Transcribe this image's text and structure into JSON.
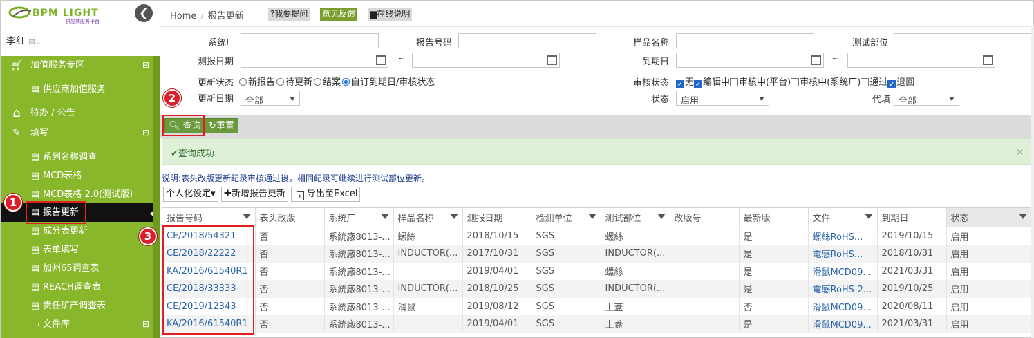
{
  "brand": {
    "logo_text": "BPM LIGHT",
    "logo_sub": "供应商服务平台"
  },
  "user": {
    "name": "李红"
  },
  "sidebar": {
    "items": [
      {
        "label": "加值服务专区",
        "icon": "cart-icon",
        "level": 1,
        "toggle": "⊟"
      },
      {
        "label": "供应商加值服务",
        "icon": "file-icon",
        "level": 2
      },
      {
        "label": "待办 / 公告",
        "icon": "home-icon",
        "level": 1
      },
      {
        "label": "填写",
        "icon": "edit-icon",
        "level": 1,
        "toggle": "⊟"
      },
      {
        "label": "系列名称调查",
        "icon": "file-icon",
        "level": 2
      },
      {
        "label": "MCD表格",
        "icon": "file-icon",
        "level": 2
      },
      {
        "label": "MCD表格 2.0(测试版)",
        "icon": "file-icon",
        "level": 2
      },
      {
        "label": "报告更新",
        "icon": "file-icon",
        "level": 2,
        "active": true
      },
      {
        "label": "成分表更新",
        "icon": "file-icon",
        "level": 2
      },
      {
        "label": "表单填写",
        "icon": "file-icon",
        "level": 2
      },
      {
        "label": "加州65调查表",
        "icon": "file-icon",
        "level": 2
      },
      {
        "label": "REACH调查表",
        "icon": "file-icon",
        "level": 2
      },
      {
        "label": "责任矿产调查表",
        "icon": "file-icon",
        "level": 2
      },
      {
        "label": "文件库",
        "icon": "folder-icon",
        "level": 2,
        "toggle": "⊟"
      }
    ]
  },
  "badges": [
    "1",
    "2",
    "3"
  ],
  "breadcrumb": {
    "home": "Home",
    "sep": "/",
    "current": "报告更新"
  },
  "toolbar": {
    "ask": "?我要提问",
    "feedback": "意见反馈",
    "help": "在线说明"
  },
  "filters": {
    "factory_label": "系统厂",
    "report_no_label": "报告号码",
    "sample_label": "样品名称",
    "part_label": "测试部位",
    "test_date_label": "测报日期",
    "tilde": "~",
    "due_label": "到期日",
    "update_status_label": "更新状态",
    "update_status_options": [
      {
        "label": "新报告",
        "checked": false
      },
      {
        "label": "待更新",
        "checked": false
      },
      {
        "label": "结案",
        "checked": false
      },
      {
        "label": "自订到期日/审核状态",
        "checked": true
      }
    ],
    "review_label": "审核状态",
    "review_options": [
      {
        "label": "无",
        "checked": true
      },
      {
        "label": "编辑中",
        "checked": true
      },
      {
        "label": "审核中(平台)",
        "checked": false
      },
      {
        "label": "审核中(系统厂)",
        "checked": false
      },
      {
        "label": "通过",
        "checked": false
      },
      {
        "label": "退回",
        "checked": true
      }
    ],
    "update_date_label": "更新日期",
    "update_date_value": "全部",
    "status_label": "状态",
    "status_value": "启用",
    "proxy_label": "代填",
    "proxy_value": "全部"
  },
  "actions": {
    "query": "查询",
    "reset": "重置"
  },
  "alert": {
    "text": "查询成功",
    "close": "×"
  },
  "note": "说明:表头改版更新纪录审核通过後，相同纪录可继续进行测试部位更新。",
  "table_tools": {
    "personal": "个人化设定",
    "add": "新增报告更新",
    "export": "导出至Excel"
  },
  "table": {
    "columns": [
      {
        "label": "报告号码",
        "filter": true
      },
      {
        "label": "表头改版",
        "filter": false
      },
      {
        "label": "系统厂",
        "filter": true
      },
      {
        "label": "样品名称",
        "filter": true
      },
      {
        "label": "测报日期",
        "filter": false
      },
      {
        "label": "检测单位",
        "filter": true
      },
      {
        "label": "测试部位",
        "filter": true
      },
      {
        "label": "改版号",
        "filter": false
      },
      {
        "label": "最新版",
        "filter": false
      },
      {
        "label": "文件",
        "filter": true
      },
      {
        "label": "到期日",
        "filter": false
      },
      {
        "label": "状态",
        "filter": true
      }
    ],
    "rows": [
      [
        "CE/2018/54321",
        "否",
        "系統廠8013-...",
        "螺絲",
        "2018/10/15",
        "SGS",
        "螺絲",
        "",
        "是",
        "螺絲RoHS...",
        "2019/10/15",
        "启用"
      ],
      [
        "CE/2018/22222",
        "否",
        "系統廠8013-...",
        "INDUCTOR(...",
        "2017/10/31",
        "SGS",
        "INDUCTOR(...",
        "",
        "是",
        "電感RoHS...",
        "2018/10/31",
        "启用"
      ],
      [
        "KA/2016/61540R1",
        "否",
        "系統廠8013-...",
        "",
        "2019/04/01",
        "SGS",
        "螺絲",
        "",
        "是",
        "滑鼠MCD09...",
        "2021/03/31",
        "启用"
      ],
      [
        "CE/2018/33333",
        "否",
        "系統廠8013-...",
        "INDUCTOR(...",
        "2018/10/25",
        "SGS",
        "INDUCTOR(...",
        "",
        "是",
        "電感RoHS-2...",
        "2019/10/25",
        "启用"
      ],
      [
        "CE/2019/12343",
        "否",
        "系統廠8013-...",
        "滑鼠",
        "2019/08/12",
        "SGS",
        "上蓋",
        "",
        "否",
        "滑鼠MCD09...",
        "2020/08/11",
        "启用"
      ],
      [
        "KA/2016/61540R1",
        "否",
        "系統廠8013-...",
        "",
        "2019/04/01",
        "SGS",
        "上蓋",
        "",
        "是",
        "滑鼠MCD09...",
        "2021/03/31",
        "启用"
      ]
    ]
  },
  "colors": {
    "sidebar": "#89b72c",
    "accent_green": "#6b9a3d",
    "alert_bg": "#dff0d8",
    "highlight_red": "#e02020",
    "link": "#2a63a8"
  }
}
